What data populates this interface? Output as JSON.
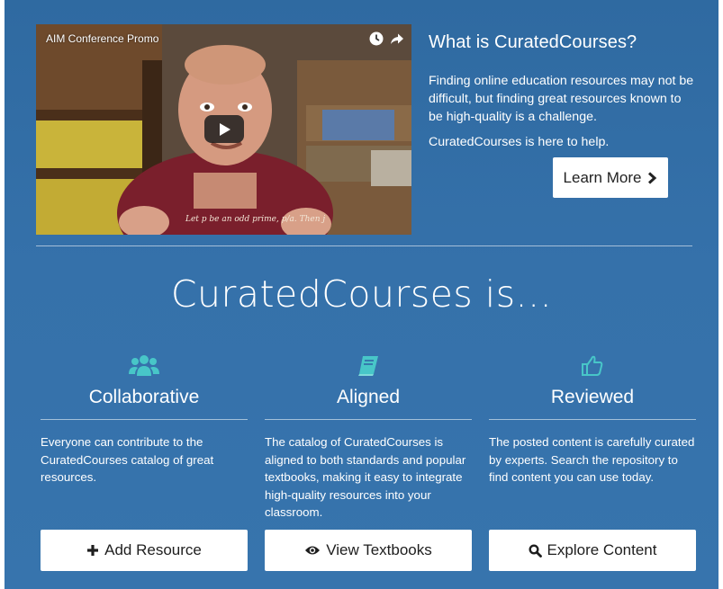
{
  "video": {
    "title": "AIM Conference Promo",
    "controls": [
      "clock-icon",
      "share-icon"
    ],
    "play_icon": "play-icon",
    "shirt_text": "Let p be an odd prime, p/a. Then j"
  },
  "intro": {
    "heading": "What is CuratedCourses?",
    "paragraph1": "Finding online education resources may not be difficult, but finding great resources known to be high-quality is a challenge.",
    "paragraph2": "CuratedCourses is here to help.",
    "learn_more_label": "Learn More",
    "learn_more_icon": "chevron-right-icon"
  },
  "headline": "CuratedCourses is...",
  "features": [
    {
      "icon": "users-icon",
      "title": "Collaborative",
      "description": "Everyone can contribute to the CuratedCourses catalog of great resources.",
      "button_label": "Add Resource",
      "button_icon": "plus-icon"
    },
    {
      "icon": "book-icon",
      "title": "Aligned",
      "description": "The catalog of CuratedCourses is aligned to both standards and popular textbooks, making it easy to integrate high-quality resources into your classroom.",
      "button_label": "View Textbooks",
      "button_icon": "eye-icon"
    },
    {
      "icon": "thumbs-up-icon",
      "title": "Reviewed",
      "description": "The posted content is carefully curated by experts. Search the repository to find content you can use today.",
      "button_label": "Explore Content",
      "button_icon": "search-icon"
    }
  ],
  "colors": {
    "panel": "#3370a9",
    "accent_icon": "#48c6c8",
    "button_bg": "#ffffff",
    "button_text": "#1e1e1e"
  }
}
